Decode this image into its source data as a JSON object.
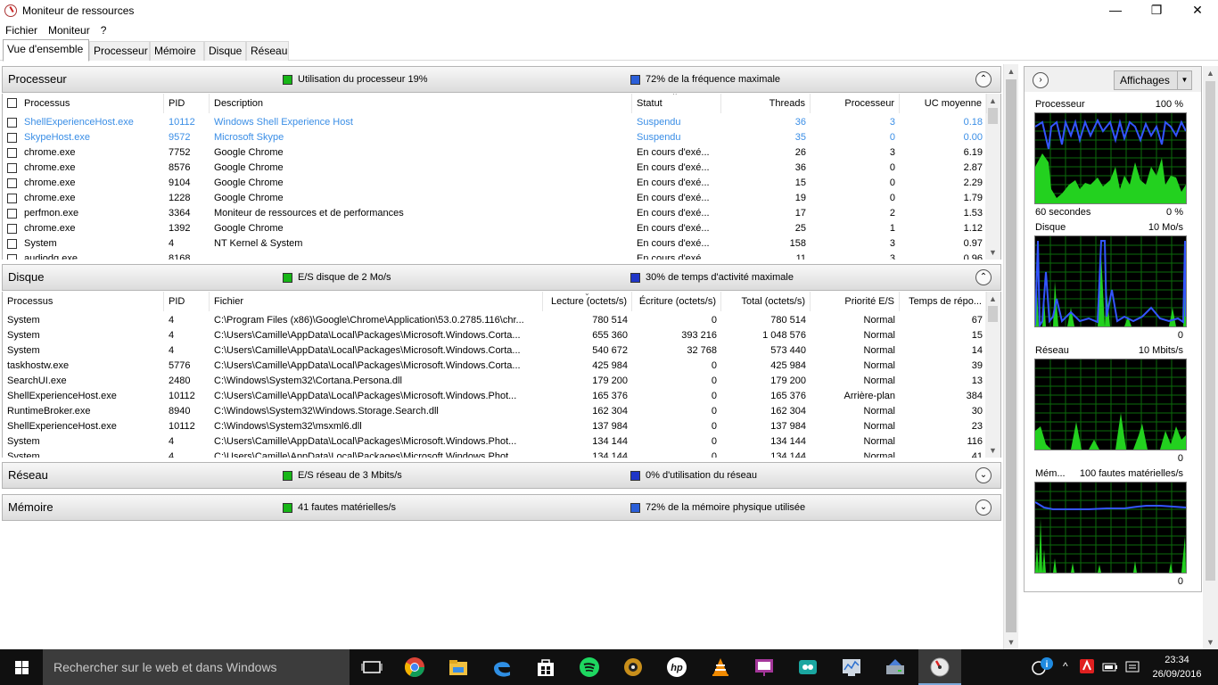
{
  "window": {
    "title": "Moniteur de ressources",
    "minimize": "—",
    "restore": "❐",
    "close": "✕"
  },
  "menu": [
    "Fichier",
    "Moniteur",
    "?"
  ],
  "tabs": [
    "Vue d'ensemble",
    "Processeur",
    "Mémoire",
    "Disque",
    "Réseau"
  ],
  "cpu": {
    "title": "Processeur",
    "stat1": "Utilisation du processeur 19%",
    "stat2": "72% de la fréquence maximale",
    "columns": [
      "Processus",
      "PID",
      "Description",
      "Statut",
      "Threads",
      "Processeur",
      "UC moyenne"
    ],
    "rows": [
      {
        "name": "ShellExperienceHost.exe",
        "pid": "10112",
        "desc": "Windows Shell Experience Host",
        "status": "Suspendu",
        "threads": "36",
        "cpu": "3",
        "avg": "0.18",
        "suspended": true
      },
      {
        "name": "SkypeHost.exe",
        "pid": "9572",
        "desc": "Microsoft Skype",
        "status": "Suspendu",
        "threads": "35",
        "cpu": "0",
        "avg": "0.00",
        "suspended": true
      },
      {
        "name": "chrome.exe",
        "pid": "7752",
        "desc": "Google Chrome",
        "status": "En cours d'exé...",
        "threads": "26",
        "cpu": "3",
        "avg": "6.19"
      },
      {
        "name": "chrome.exe",
        "pid": "8576",
        "desc": "Google Chrome",
        "status": "En cours d'exé...",
        "threads": "36",
        "cpu": "0",
        "avg": "2.87"
      },
      {
        "name": "chrome.exe",
        "pid": "9104",
        "desc": "Google Chrome",
        "status": "En cours d'exé...",
        "threads": "15",
        "cpu": "0",
        "avg": "2.29"
      },
      {
        "name": "chrome.exe",
        "pid": "1228",
        "desc": "Google Chrome",
        "status": "En cours d'exé...",
        "threads": "19",
        "cpu": "0",
        "avg": "1.79"
      },
      {
        "name": "perfmon.exe",
        "pid": "3364",
        "desc": "Moniteur de ressources et de performances",
        "status": "En cours d'exé...",
        "threads": "17",
        "cpu": "2",
        "avg": "1.53"
      },
      {
        "name": "chrome.exe",
        "pid": "1392",
        "desc": "Google Chrome",
        "status": "En cours d'exé...",
        "threads": "25",
        "cpu": "1",
        "avg": "1.12"
      },
      {
        "name": "System",
        "pid": "4",
        "desc": "NT Kernel & System",
        "status": "En cours d'exé...",
        "threads": "158",
        "cpu": "3",
        "avg": "0.97"
      },
      {
        "name": "audiodg.exe",
        "pid": "8168",
        "desc": "",
        "status": "En cours d'exé...",
        "threads": "11",
        "cpu": "3",
        "avg": "0.96"
      }
    ]
  },
  "disk": {
    "title": "Disque",
    "stat1": "E/S disque de 2 Mo/s",
    "stat2": "30% de temps d'activité maximale",
    "columns": [
      "Processus",
      "PID",
      "Fichier",
      "Lecture (octets/s)",
      "Écriture (octets/s)",
      "Total (octets/s)",
      "Priorité E/S",
      "Temps de répo..."
    ],
    "rows": [
      {
        "name": "System",
        "pid": "4",
        "file": "C:\\Program Files (x86)\\Google\\Chrome\\Application\\53.0.2785.116\\chr...",
        "read": "780 514",
        "write": "0",
        "total": "780 514",
        "prio": "Normal",
        "resp": "67"
      },
      {
        "name": "System",
        "pid": "4",
        "file": "C:\\Users\\Camille\\AppData\\Local\\Packages\\Microsoft.Windows.Corta...",
        "read": "655 360",
        "write": "393 216",
        "total": "1 048 576",
        "prio": "Normal",
        "resp": "15"
      },
      {
        "name": "System",
        "pid": "4",
        "file": "C:\\Users\\Camille\\AppData\\Local\\Packages\\Microsoft.Windows.Corta...",
        "read": "540 672",
        "write": "32 768",
        "total": "573 440",
        "prio": "Normal",
        "resp": "14"
      },
      {
        "name": "taskhostw.exe",
        "pid": "5776",
        "file": "C:\\Users\\Camille\\AppData\\Local\\Packages\\Microsoft.Windows.Corta...",
        "read": "425 984",
        "write": "0",
        "total": "425 984",
        "prio": "Normal",
        "resp": "39"
      },
      {
        "name": "SearchUI.exe",
        "pid": "2480",
        "file": "C:\\Windows\\System32\\Cortana.Persona.dll",
        "read": "179 200",
        "write": "0",
        "total": "179 200",
        "prio": "Normal",
        "resp": "13"
      },
      {
        "name": "ShellExperienceHost.exe",
        "pid": "10112",
        "file": "C:\\Users\\Camille\\AppData\\Local\\Packages\\Microsoft.Windows.Phot...",
        "read": "165 376",
        "write": "0",
        "total": "165 376",
        "prio": "Arrière-plan",
        "resp": "384"
      },
      {
        "name": "RuntimeBroker.exe",
        "pid": "8940",
        "file": "C:\\Windows\\System32\\Windows.Storage.Search.dll",
        "read": "162 304",
        "write": "0",
        "total": "162 304",
        "prio": "Normal",
        "resp": "30"
      },
      {
        "name": "ShellExperienceHost.exe",
        "pid": "10112",
        "file": "C:\\Windows\\System32\\msxml6.dll",
        "read": "137 984",
        "write": "0",
        "total": "137 984",
        "prio": "Normal",
        "resp": "23"
      },
      {
        "name": "System",
        "pid": "4",
        "file": "C:\\Users\\Camille\\AppData\\Local\\Packages\\Microsoft.Windows.Phot...",
        "read": "134 144",
        "write": "0",
        "total": "134 144",
        "prio": "Normal",
        "resp": "116"
      },
      {
        "name": "System",
        "pid": "4",
        "file": "C:\\Users\\Camille\\AppData\\Local\\Packages\\Microsoft.Windows.Phot...",
        "read": "134 144",
        "write": "0",
        "total": "134 144",
        "prio": "Normal",
        "resp": "41"
      }
    ]
  },
  "network": {
    "title": "Réseau",
    "stat1": "E/S réseau de 3 Mbits/s",
    "stat2": "0% d'utilisation du réseau"
  },
  "memory": {
    "title": "Mémoire",
    "stat1": "41 fautes matérielles/s",
    "stat2": "72% de la mémoire physique utilisée"
  },
  "side": {
    "views_label": "Affichages",
    "graphs": [
      {
        "title": "Processeur",
        "max": "100 %",
        "footer_left": "60 secondes",
        "footer_right": "0 %"
      },
      {
        "title": "Disque",
        "max": "10 Mo/s",
        "footer_left": "",
        "footer_right": "0"
      },
      {
        "title": "Réseau",
        "max": "10 Mbits/s",
        "footer_left": "",
        "footer_right": "0"
      },
      {
        "title": "Mém...",
        "max": "100 fautes matérielles/s",
        "footer_left": "",
        "footer_right": "0"
      }
    ]
  },
  "taskbar": {
    "search_placeholder": "Rechercher sur le web et dans Windows",
    "time": "23:34",
    "date": "26/09/2016"
  },
  "colors": {
    "graph_green": "#23d11f",
    "graph_blue": "#3355ff",
    "suspended_text": "#3a8ee6"
  }
}
